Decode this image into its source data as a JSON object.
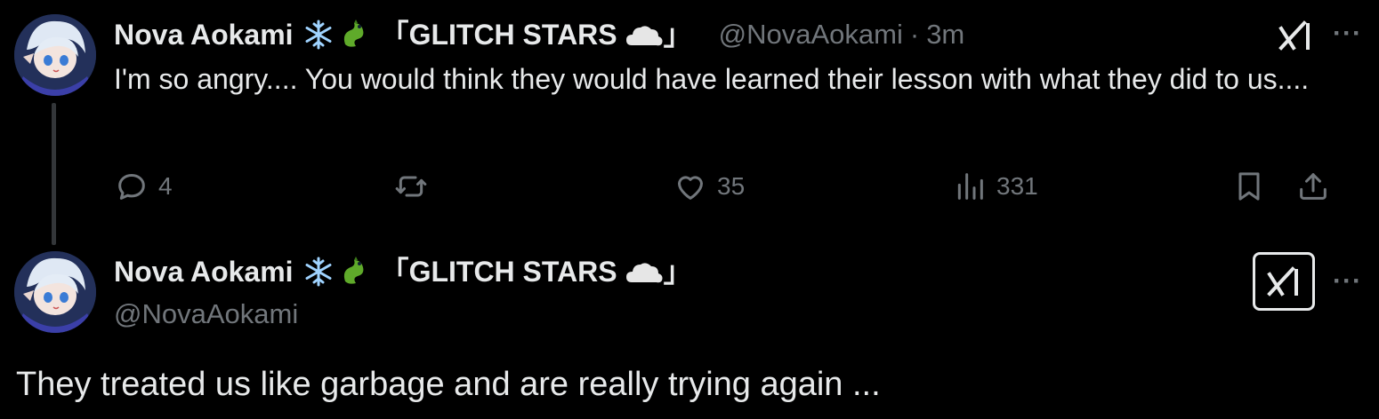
{
  "posts": [
    {
      "author": {
        "display_name": "Nova Aokami",
        "badge_open": "「",
        "badge_text": "GLITCH STARS",
        "badge_close": "」",
        "handle": "@NovaAokami"
      },
      "separator": "·",
      "time": "3m",
      "text": "I'm so angry.... You would think they would have learned their lesson with what they did to us....",
      "actions": {
        "replies": "4",
        "reposts": "",
        "likes": "35",
        "views": "331"
      },
      "more_label": "···"
    },
    {
      "author": {
        "display_name": "Nova Aokami",
        "badge_open": "「",
        "badge_text": "GLITCH STARS",
        "badge_close": "」",
        "handle": "@NovaAokami"
      },
      "text": "They treated us like garbage and are really trying again ...",
      "more_label": "···"
    }
  ],
  "icons": [
    "avatar",
    "snowflake-icon",
    "dragon-icon",
    "cloud-icon",
    "grok-icon",
    "more-icon",
    "reply-icon",
    "repost-icon",
    "like-icon",
    "views-icon",
    "bookmark-icon",
    "share-icon"
  ],
  "colors": {
    "background": "#000000",
    "text": "#e7e9ea",
    "muted": "#71767b",
    "thread_line": "#333639"
  }
}
